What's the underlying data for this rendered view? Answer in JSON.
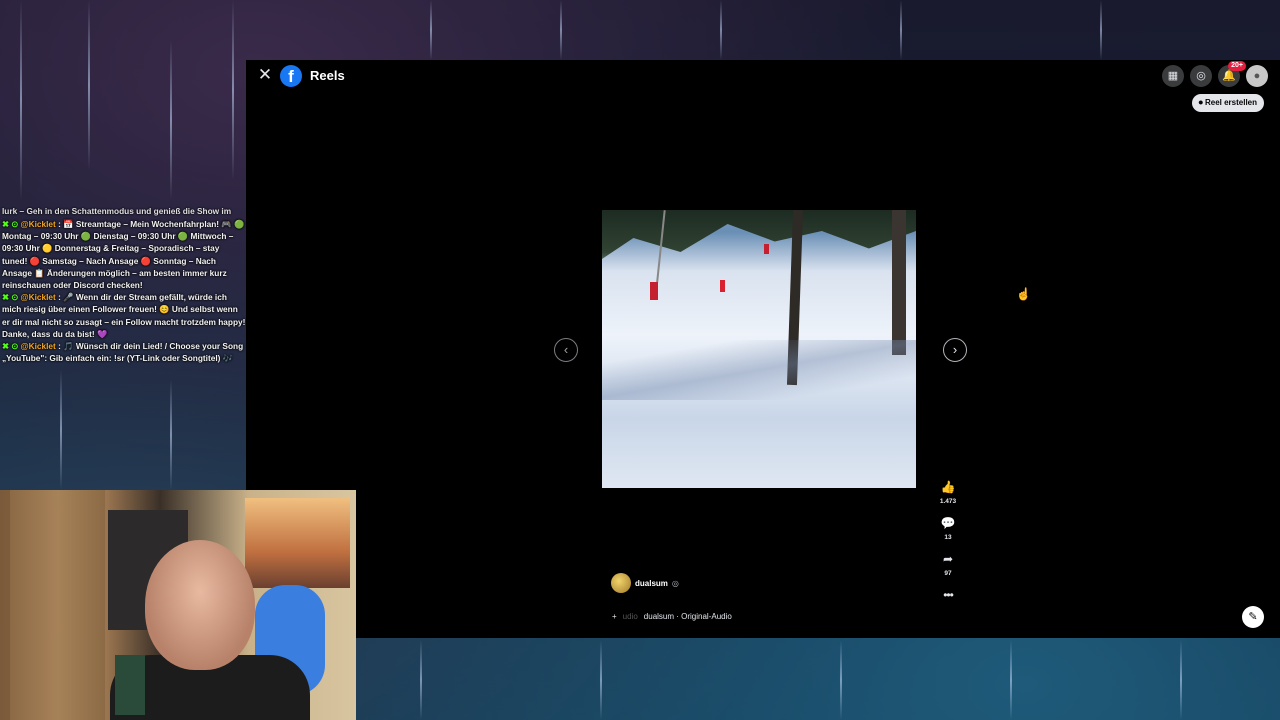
{
  "header": {
    "close_glyph": "✕",
    "logo_glyph": "f",
    "title": "Reels",
    "notifications_badge": "20+",
    "create_reel_label": "Reel erstellen"
  },
  "chat": {
    "messages": [
      {
        "text": "lurk – Geh in den Schattenmodus und genieß die Show im Verborgenen."
      },
      {
        "user": "@Kicklet",
        "text": " : 📅 Streamtage – Mein Wochenfahrplan! 🎮 🟢 Montag – 09:30 Uhr 🟢 Dienstag – 09:30 Uhr 🟢 Mittwoch – 09:30 Uhr 🟡 Donnerstag & Freitag – Sporadisch – stay tuned! 🔴 Samstag – Nach Ansage 🔴 Sonntag – Nach Ansage 📋 Änderungen möglich – am besten immer kurz reinschauen oder Discord checken!"
      },
      {
        "user": "@Kicklet",
        "text": " : 🎤 Wenn dir der Stream gefällt, würde ich mich riesig über einen Follower freuen! 😊 Und selbst wenn er dir mal nicht so zusagt – ein Follow macht trotzdem happy! Danke, dass du da bist! 💜"
      },
      {
        "user": "@Kicklet",
        "text": " : 🎵 Wünsch dir dein Lied! / Choose your Song „YouTube\": Gib einfach ein: !sr (YT-Link oder Songtitel) 🎶"
      }
    ]
  },
  "reel": {
    "likes": "1.473",
    "comments": "13",
    "shares": "97",
    "author": "dualsum",
    "audio_prefix": "udio",
    "audio_label": "dualsum · Original-Audio"
  },
  "icons": {
    "prev": "‹",
    "next": "›",
    "like": "👍",
    "comment": "💬",
    "share": "➦",
    "more": "•••",
    "compose": "✎"
  }
}
